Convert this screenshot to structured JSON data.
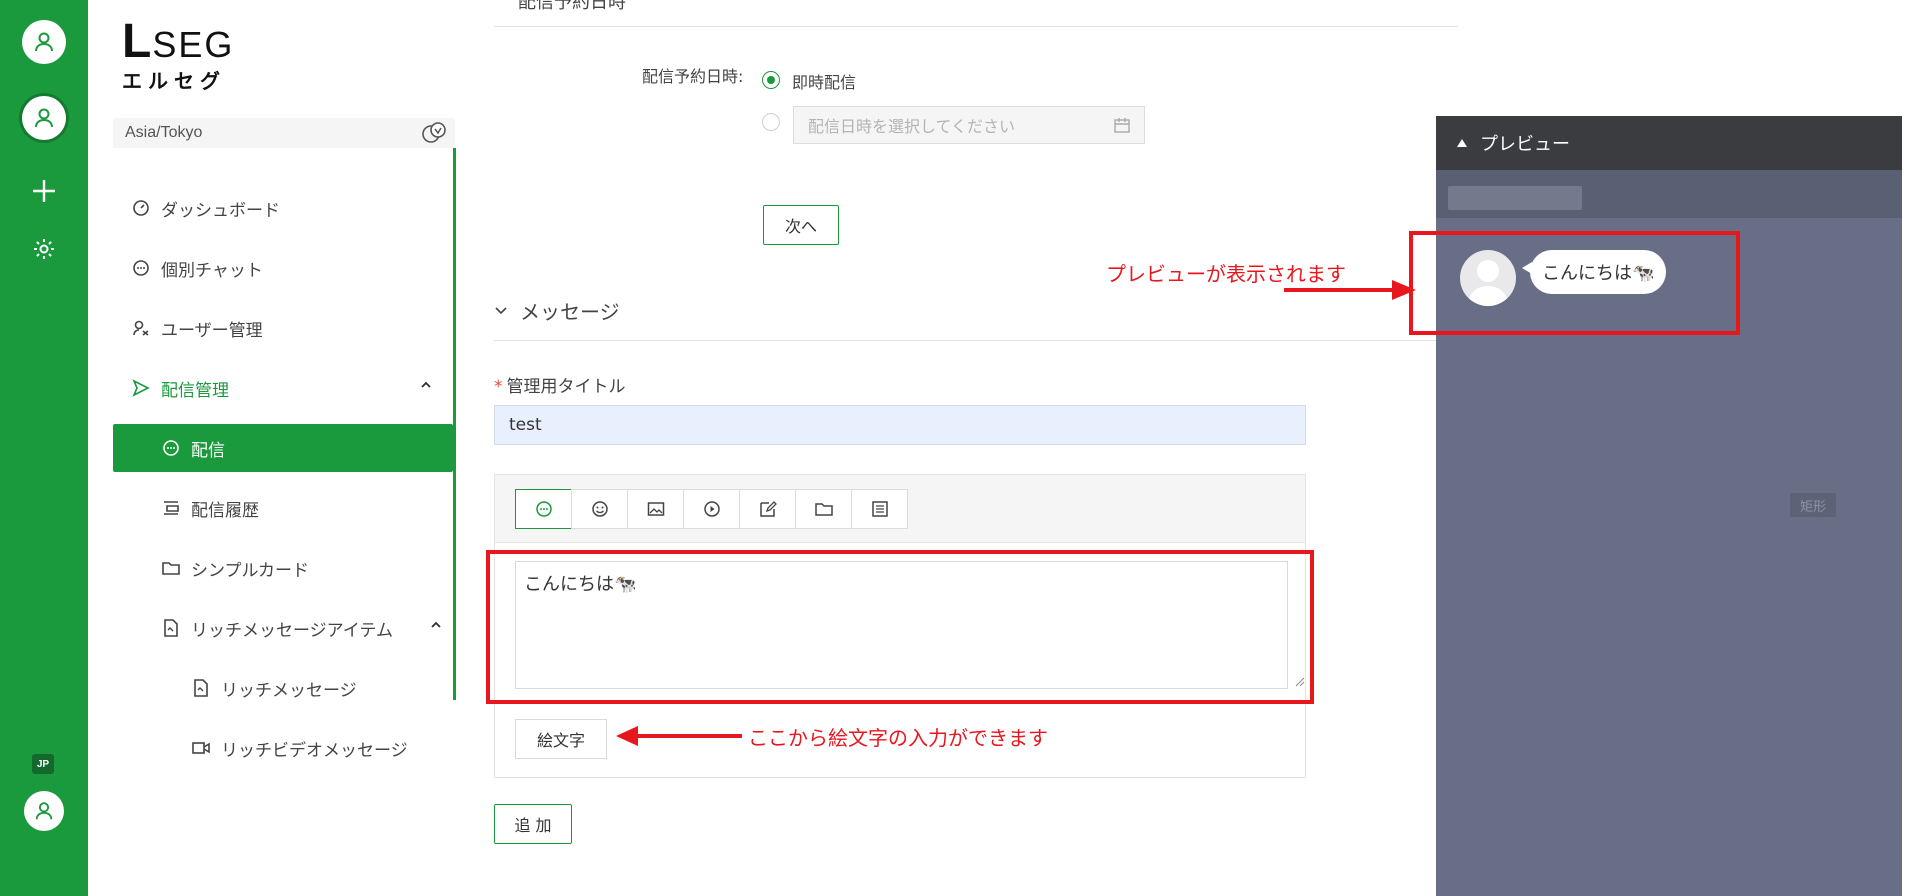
{
  "rail": {
    "lang_badge": "JP",
    "icons": [
      "user-icon",
      "user-icon",
      "plus-icon",
      "gear-icon",
      "user-icon"
    ]
  },
  "sidebar": {
    "logo_latin_big": "L",
    "logo_latin_rest": "SEG",
    "logo_kana": "エルセグ",
    "timezone": "Asia/Tokyo",
    "items": [
      {
        "label": "ダッシュボード",
        "icon": "dashboard-icon"
      },
      {
        "label": "個別チャット",
        "icon": "chat-icon"
      },
      {
        "label": "ユーザー管理",
        "icon": "users-icon"
      },
      {
        "label": "配信管理",
        "icon": "send-icon"
      },
      {
        "label": "配信",
        "icon": "chat-icon"
      },
      {
        "label": "配信履歴",
        "icon": "history-icon"
      },
      {
        "label": "シンプルカード",
        "icon": "folder-icon"
      },
      {
        "label": "リッチメッセージアイテム",
        "icon": "file-icon"
      },
      {
        "label": "リッチメッセージ",
        "icon": "file-icon"
      },
      {
        "label": "リッチビデオメッセージ",
        "icon": "video-icon"
      }
    ]
  },
  "schedule": {
    "section_title": "配信予約日時",
    "label": "配信予約日時:",
    "immediate_label": "即時配信",
    "date_placeholder": "配信日時を選択してください",
    "next_button": "次へ"
  },
  "message": {
    "section_title": "メッセージ",
    "title_label": "管理用タイトル",
    "title_value": "test",
    "tools": [
      "message-icon",
      "sticker-icon",
      "image-icon",
      "video-icon",
      "edit-icon",
      "folder-icon",
      "list-icon"
    ],
    "text": "こんにちは🐄",
    "emoji_button": "絵文字",
    "add_button": "追 加"
  },
  "annotations": {
    "preview_note": "プレビューが表示されます",
    "emoji_note": "ここから絵文字の入力ができます",
    "color": "#e8161d"
  },
  "preview": {
    "title": "プレビュー",
    "bubble_text": "こんにちは🐄",
    "shape_label": "矩形"
  },
  "colors": {
    "brand_green": "#1a9a3c",
    "preview_bg": "#676e86",
    "preview_header": "#3a3c40"
  }
}
